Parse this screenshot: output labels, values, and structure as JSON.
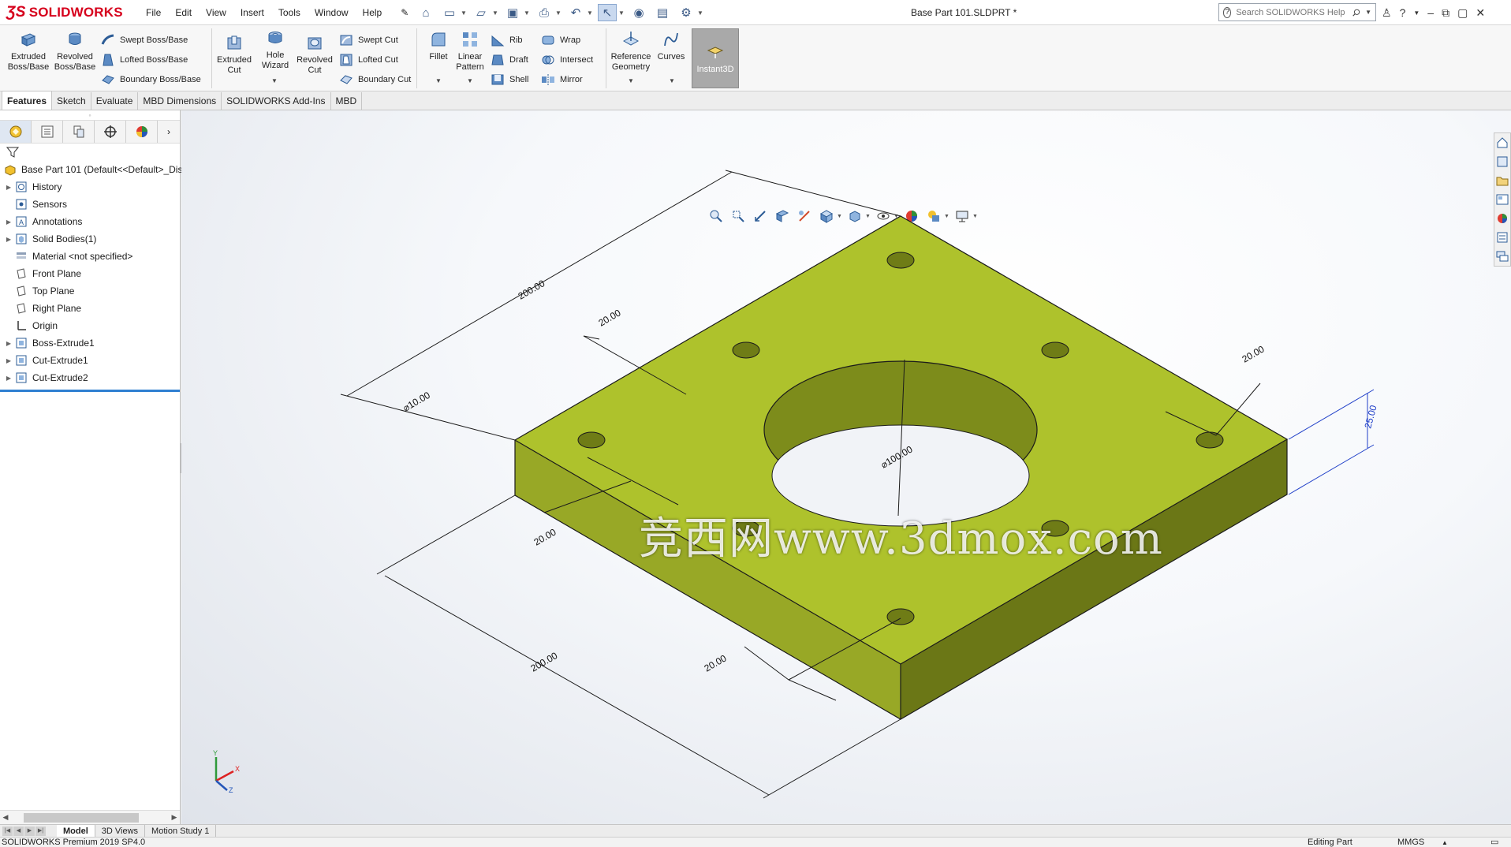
{
  "app": {
    "brand": "SOLIDWORKS",
    "doc_title": "Base Part 101.SLDPRT *",
    "menu": [
      "File",
      "Edit",
      "View",
      "Insert",
      "Tools",
      "Window",
      "Help"
    ],
    "search_placeholder": "Search SOLIDWORKS Help"
  },
  "commands": {
    "extruded_boss": "Extruded Boss/Base",
    "revolved_boss": "Revolved Boss/Base",
    "swept_boss": "Swept Boss/Base",
    "lofted_boss": "Lofted Boss/Base",
    "boundary_boss": "Boundary Boss/Base",
    "extruded_cut": "Extruded Cut",
    "hole_wizard": "Hole Wizard",
    "revolved_cut": "Revolved Cut",
    "swept_cut": "Swept Cut",
    "lofted_cut": "Lofted Cut",
    "boundary_cut": "Boundary Cut",
    "fillet": "Fillet",
    "linear_pattern": "Linear Pattern",
    "rib": "Rib",
    "draft": "Draft",
    "shell": "Shell",
    "wrap": "Wrap",
    "intersect": "Intersect",
    "mirror": "Mirror",
    "reference_geometry": "Reference Geometry",
    "curves": "Curves",
    "instant3d": "Instant3D"
  },
  "tabs": [
    "Features",
    "Sketch",
    "Evaluate",
    "MBD Dimensions",
    "SOLIDWORKS Add-Ins",
    "MBD"
  ],
  "tree": {
    "root": "Base Part 101  (Default<<Default>_Dis",
    "items": [
      {
        "label": "History",
        "expand": true
      },
      {
        "label": "Sensors",
        "expand": false
      },
      {
        "label": "Annotations",
        "expand": true
      },
      {
        "label": "Solid Bodies(1)",
        "expand": true
      },
      {
        "label": "Material <not specified>",
        "expand": false
      },
      {
        "label": "Front Plane",
        "expand": false
      },
      {
        "label": "Top Plane",
        "expand": false
      },
      {
        "label": "Right Plane",
        "expand": false
      },
      {
        "label": "Origin",
        "expand": false
      },
      {
        "label": "Boss-Extrude1",
        "expand": true
      },
      {
        "label": "Cut-Extrude1",
        "expand": true
      },
      {
        "label": "Cut-Extrude2",
        "expand": true
      }
    ]
  },
  "model": {
    "face_color": "#aec22c",
    "front_color": "#98a826",
    "side_color": "#6b7716",
    "dimensions": {
      "length_top": "200.00",
      "edge_top": "20.00",
      "hole_small": "⌀10.00",
      "edge_left": "20.00",
      "bore": "⌀100.00",
      "edge_right": "20.00",
      "thickness": "25.00",
      "length_bottom": "200.00",
      "edge_bottom": "20.00"
    },
    "watermark": "竞西网www.3dmox.com"
  },
  "bottom_tabs": [
    "Model",
    "3D Views",
    "Motion Study 1"
  ],
  "status": {
    "version": "SOLIDWORKS Premium 2019 SP4.0",
    "mode": "Editing Part",
    "units": "MMGS"
  }
}
